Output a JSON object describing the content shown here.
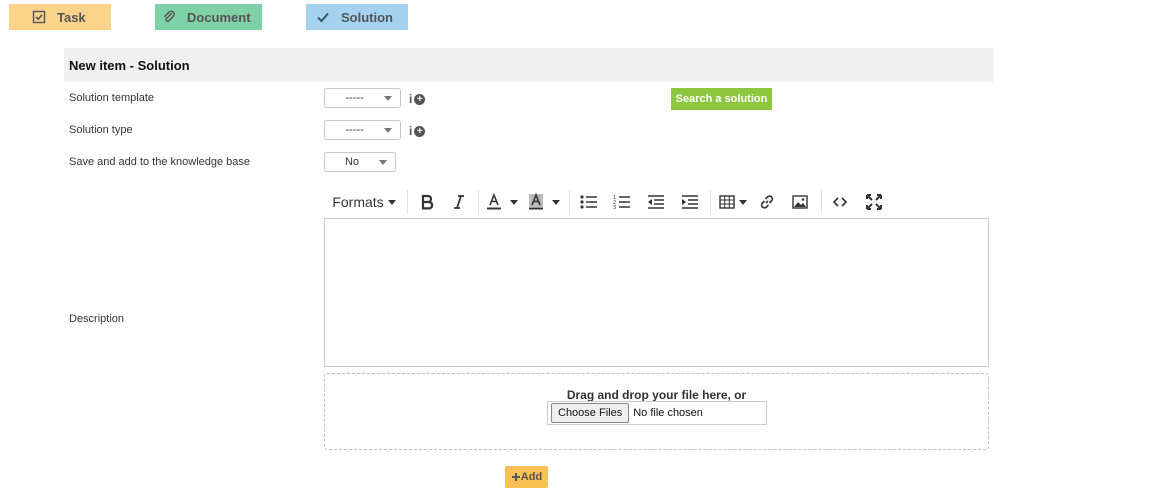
{
  "tabs": [
    {
      "label": "Task",
      "icon": "checkbox-icon",
      "color": "#fbd38b"
    },
    {
      "label": "Document",
      "icon": "paperclip-icon",
      "color": "#7fd1a8"
    },
    {
      "label": "Solution",
      "icon": "checkmark-icon",
      "color": "#a5d3ef"
    }
  ],
  "form": {
    "title": "New item - Solution",
    "fields": {
      "solution_template": {
        "label": "Solution template",
        "value": "-----"
      },
      "solution_type": {
        "label": "Solution type",
        "value": "-----"
      },
      "knowledge_base": {
        "label": "Save and add to the knowledge base",
        "value": "No"
      },
      "description": {
        "label": "Description"
      }
    },
    "info_glyph": "i",
    "search_button": "Search a solution",
    "toolbar": {
      "formats": "Formats",
      "buttons": [
        "bold-icon",
        "italic-icon",
        "text-color-icon",
        "background-color-icon",
        "bullet-list-icon",
        "numbered-list-icon",
        "outdent-icon",
        "indent-icon",
        "table-icon",
        "link-icon",
        "image-icon",
        "code-icon",
        "fullscreen-icon"
      ]
    },
    "dropzone": {
      "text": "Drag and drop your file here, or",
      "choose_label": "Choose Files",
      "no_file": "No file chosen"
    },
    "add_button": "Add"
  },
  "colors": {
    "accent_green": "#8dc63f",
    "add_yellow": "#f6c052",
    "header_bg": "#f0f0f0"
  }
}
